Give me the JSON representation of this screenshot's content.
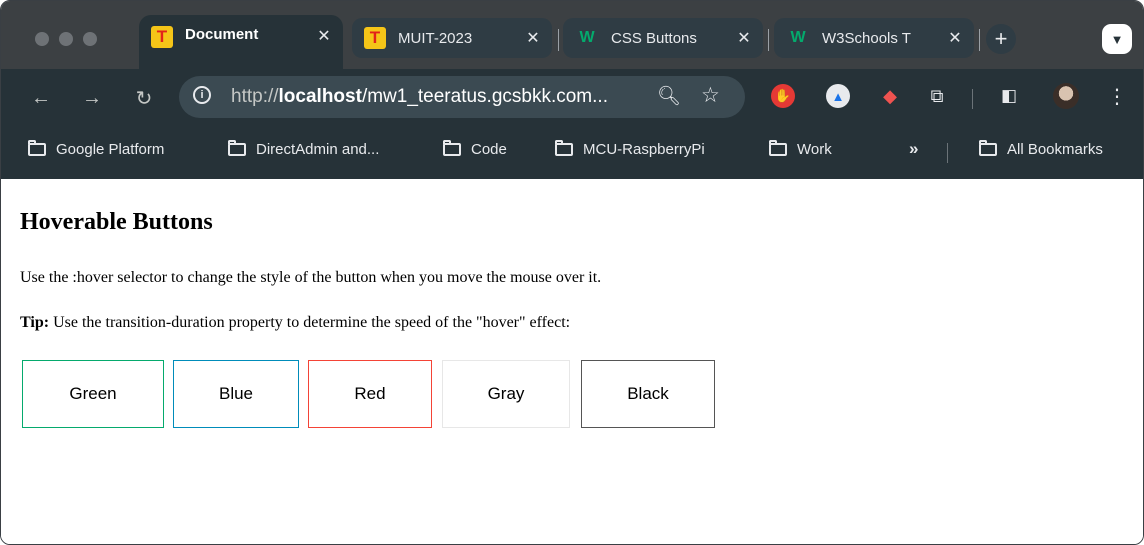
{
  "browser": {
    "tabs": [
      {
        "title": "Document",
        "favicon": "T",
        "active": true
      },
      {
        "title": "MUIT-2023",
        "favicon": "T",
        "active": false
      },
      {
        "title": "CSS Buttons",
        "favicon": "W",
        "active": false
      },
      {
        "title": "W3Schools T",
        "favicon": "W",
        "active": false
      }
    ],
    "new_tab_label": "+",
    "url_prefix": "http://",
    "url_host": "localhost",
    "url_rest": "/mw1_teeratus.gcsbkk.com...",
    "bookmarks": [
      {
        "label": "Google Platform"
      },
      {
        "label": "DirectAdmin and..."
      },
      {
        "label": "Code"
      },
      {
        "label": "MCU-RaspberryPi"
      },
      {
        "label": "Work"
      }
    ],
    "bookmarks_more": "»",
    "all_bookmarks": "All Bookmarks"
  },
  "page": {
    "heading": "Hoverable Buttons",
    "intro": "Use the :hover selector to change the style of the button when you move the mouse over it.",
    "tip_label": "Tip:",
    "tip_text": " Use the transition-duration property to determine the speed of the \"hover\" effect:",
    "buttons": [
      {
        "label": "Green",
        "color": "#04aa6d"
      },
      {
        "label": "Blue",
        "color": "#008cba"
      },
      {
        "label": "Red",
        "color": "#f44336"
      },
      {
        "label": "Gray",
        "color": "#e7e7e7"
      },
      {
        "label": "Black",
        "color": "#555555"
      }
    ]
  },
  "icons": {
    "back": "arrow-left-icon",
    "forward": "arrow-right-icon",
    "reload": "reload-icon",
    "site_info": "info-icon",
    "zoom": "zoom-icon",
    "bookmark_star": "star-icon",
    "folder": "folder-icon",
    "menu": "kebab-menu-icon"
  },
  "colors": {
    "frame": "#3c4043",
    "toolbar": "#263238",
    "omnibox": "#3b4a52"
  }
}
